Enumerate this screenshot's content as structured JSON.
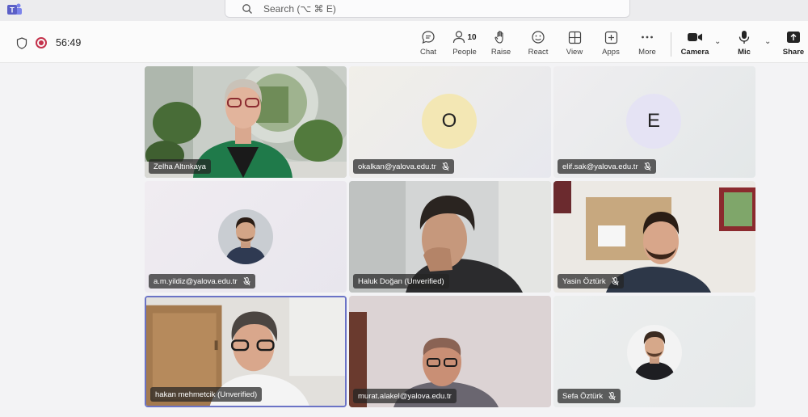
{
  "search": {
    "placeholder": "Search (⌥ ⌘ E)"
  },
  "meeting": {
    "timer": "56:49"
  },
  "toolbar": {
    "chat": "Chat",
    "people": "People",
    "people_count": "10",
    "raise": "Raise",
    "react": "React",
    "view": "View",
    "apps": "Apps",
    "more": "More",
    "camera": "Camera",
    "mic": "Mic",
    "share": "Share"
  },
  "participants": [
    {
      "name": "Zelha Altınkaya",
      "muted": false,
      "video": true
    },
    {
      "name": "okalkan@yalova.edu.tr",
      "muted": true,
      "video": false,
      "initial": "O",
      "avatar_color": "#f3e7b4"
    },
    {
      "name": "elif.sak@yalova.edu.tr",
      "muted": true,
      "video": false,
      "initial": "E",
      "avatar_color": "#e5e3f4"
    },
    {
      "name": "a.m.yildiz@yalova.edu.tr",
      "muted": true,
      "video": false
    },
    {
      "name": "Haluk Doğan (Unverified)",
      "muted": false,
      "video": true
    },
    {
      "name": "Yasin Öztürk",
      "muted": true,
      "video": true
    },
    {
      "name": "hakan mehmetcik (Unverified)",
      "muted": false,
      "video": true,
      "active_speaker": true
    },
    {
      "name": "murat.alakel@yalova.edu.tr",
      "muted": false,
      "video": true
    },
    {
      "name": "Sefa Öztürk",
      "muted": true,
      "video": false
    }
  ],
  "colors": {
    "recording": "#c4314b",
    "active_speaker_border": "#6b73c6",
    "teams_purple": "#5b5fc7"
  }
}
